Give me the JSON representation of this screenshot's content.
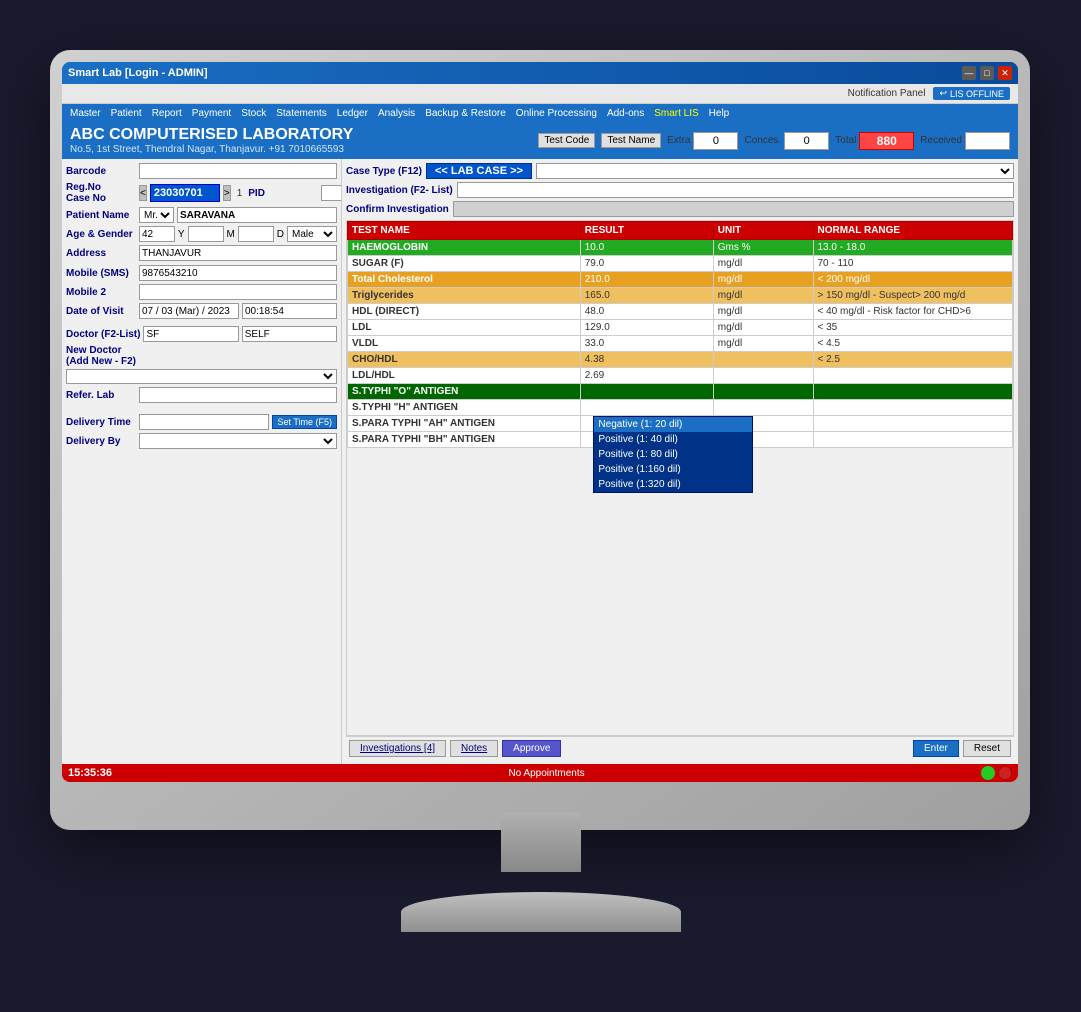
{
  "window": {
    "title": "Smart Lab [Login - ADMIN]",
    "controls": [
      "—",
      "□",
      "✕"
    ]
  },
  "notification": {
    "panel_label": "Notification Panel",
    "lis_status": "LIS OFFLINE"
  },
  "menubar": {
    "items": [
      "Master",
      "Patient",
      "Report",
      "Payment",
      "Stock",
      "Statements",
      "Ledger",
      "Analysis",
      "Backup & Restore",
      "Online Processing",
      "Add-ons",
      "Smart LIS",
      "Help"
    ]
  },
  "header": {
    "title": "ABC COMPUTERISED LABORATORY",
    "subtitle": "No.5, 1st Street, Thendral Nagar, Thanjavur. +91 7010665593"
  },
  "counters": {
    "test_code_label": "Test Code",
    "test_name_label": "Test Name",
    "extra_label": "Extra",
    "extra_value": "0",
    "conces_label": "Conces.",
    "conces_value": "0",
    "total_label": "Total",
    "total_value": "880",
    "received_label": "Received"
  },
  "patient": {
    "barcode_label": "Barcode",
    "reg_no_label": "Reg.No",
    "case_no_label": "Case No",
    "reg_value": "23030701",
    "pid_label": "PID",
    "pid_value": "1",
    "patient_name_label": "Patient Name",
    "salutation": "Mr.",
    "patient_name": "SARAVANA",
    "age_gender_label": "Age & Gender",
    "age": "42",
    "age_y": "Y",
    "age_m": "M",
    "age_d": "D",
    "gender": "Male",
    "address_label": "Address",
    "address": "THANJAVUR",
    "mobile_sms_label": "Mobile (SMS)",
    "mobile_sms": "9876543210",
    "mobile2_label": "Mobile 2",
    "dov_label": "Date of Visit",
    "dov": "07 / 03 (Mar) / 2023",
    "time": "00:18:54",
    "doctor_label": "Doctor (F2-List)",
    "doctor_code": "SF",
    "doctor_name": "SELF",
    "new_doctor_label": "New Doctor",
    "add_new_label": "(Add New - F2)",
    "refer_lab_label": "Refer. Lab",
    "delivery_time_label": "Delivery Time",
    "set_time_label": "Set Time (F5)",
    "delivery_by_label": "Delivery By"
  },
  "lab_case": {
    "case_type_label": "Case Type (F12)",
    "lab_case_badge": "<< LAB CASE >>",
    "investigation_label": "Investigation (F2- List)",
    "confirm_label": "Confirm Investigation"
  },
  "results_table": {
    "headers": [
      "TEST NAME",
      "RESULT",
      "UNIT",
      "NORMAL RANGE"
    ],
    "rows": [
      {
        "name": "HAEMOGLOBIN",
        "result": "10.0",
        "unit": "Gms %",
        "range": "13.0 - 18.0",
        "style": "green"
      },
      {
        "name": "SUGAR (F)",
        "result": "79.0",
        "unit": "mg/dl",
        "range": "70 - 110",
        "style": "white"
      },
      {
        "name": "Total Cholesterol",
        "result": "210.0",
        "unit": "mg/dl",
        "range": "< 200 mg/dl",
        "style": "orange"
      },
      {
        "name": "Triglycerides",
        "result": "165.0",
        "unit": "mg/dl",
        "range": "> 150 mg/dl  - Suspect> 200 mg/d",
        "style": "light-orange"
      },
      {
        "name": "HDL (DIRECT)",
        "result": "48.0",
        "unit": "mg/dl",
        "range": "< 40 mg/dl - Risk factor for CHD>6",
        "style": "white"
      },
      {
        "name": "LDL",
        "result": "129.0",
        "unit": "mg/dl",
        "range": "< 35",
        "style": "white"
      },
      {
        "name": "VLDL",
        "result": "33.0",
        "unit": "mg/dl",
        "range": "< 4.5",
        "style": "white"
      },
      {
        "name": "CHO/HDL",
        "result": "4.38",
        "unit": "",
        "range": "< 2.5",
        "style": "light-orange"
      },
      {
        "name": "LDL/HDL",
        "result": "2.69",
        "unit": "",
        "range": "",
        "style": "white"
      },
      {
        "name": "S.TYPHI \"O\" ANTIGEN",
        "result": "",
        "unit": "",
        "range": "",
        "style": "dark-green"
      },
      {
        "name": "S.TYPHI \"H\" ANTIGEN",
        "result": "",
        "unit": "",
        "range": "",
        "style": "white"
      },
      {
        "name": "S.PARA TYPHI \"AH\" ANTIGEN",
        "result": "",
        "unit": "",
        "range": "",
        "style": "white"
      },
      {
        "name": "S.PARA TYPHI \"BH\" ANTIGEN",
        "result": "",
        "unit": "",
        "range": "",
        "style": "white"
      }
    ]
  },
  "dropdown": {
    "options": [
      "Negative (1: 20 dil)",
      "Positive (1: 40 dil)",
      "Positive (1: 80 dil)",
      "Positive (1:160 dil)",
      "Positive (1:320 dil)"
    ]
  },
  "bottom_tabs": {
    "investigations_label": "Investigations [4]",
    "notes_label": "Notes",
    "approve_label": "Approve"
  },
  "action_buttons": {
    "enter_label": "Enter",
    "reset_label": "Reset"
  },
  "status_bar": {
    "time": "15:35:36",
    "message": "No Appointments"
  }
}
